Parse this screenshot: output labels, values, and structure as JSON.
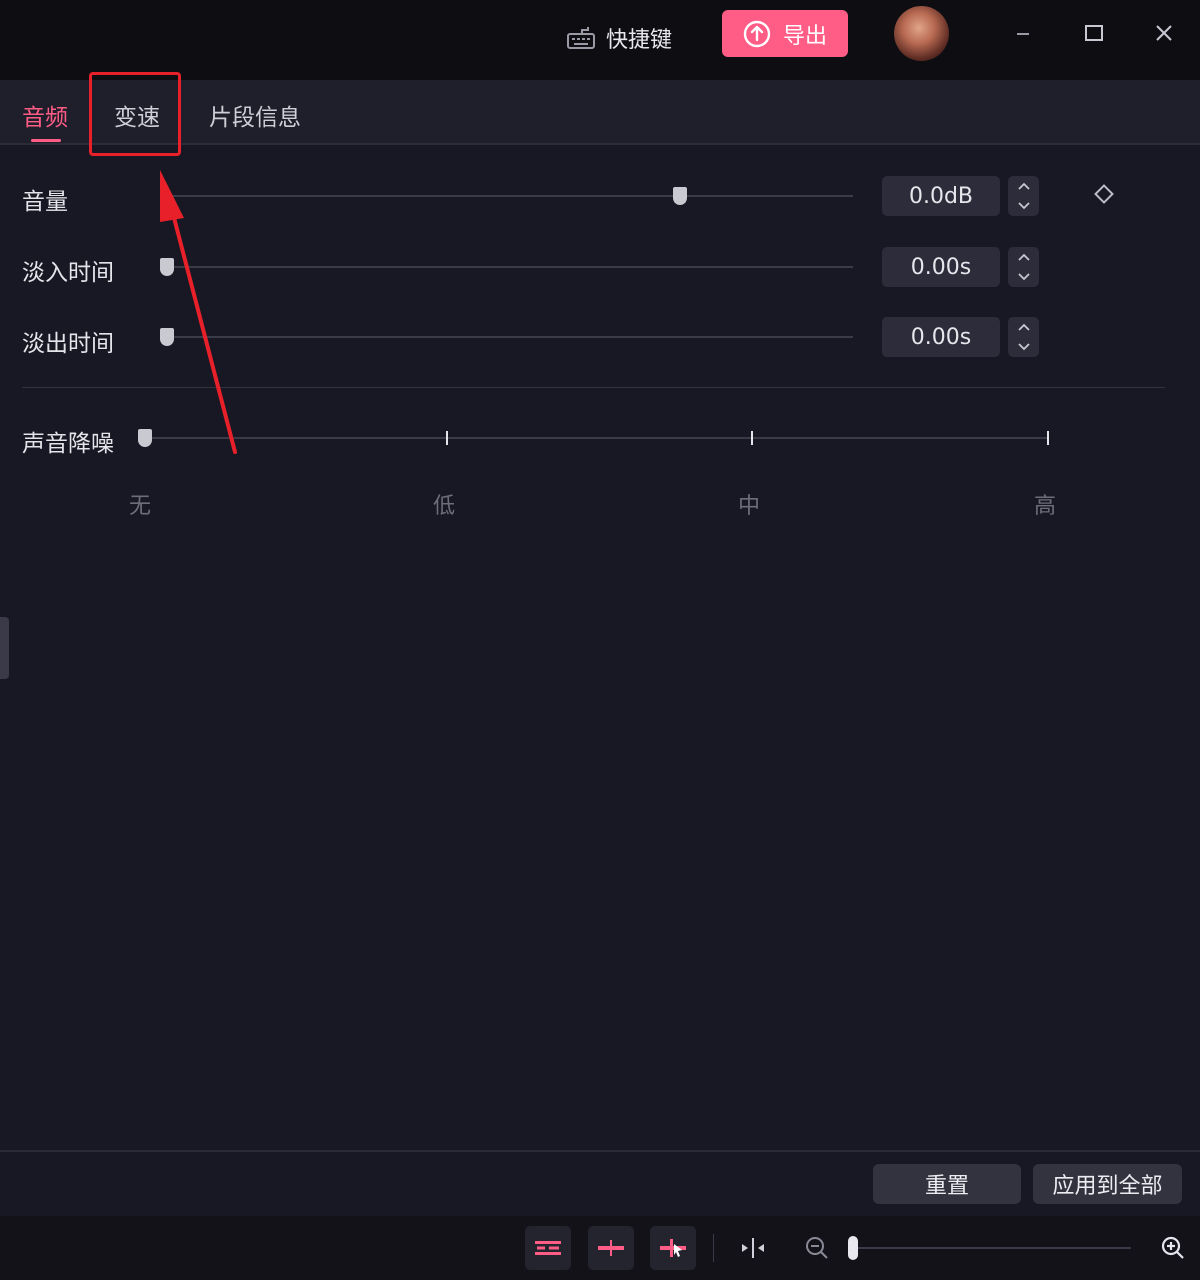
{
  "titlebar": {
    "shortcut_label": "快捷键",
    "shortcut_icon": "keyboard-icon",
    "export_label": "导出",
    "export_icon": "upload-icon",
    "export_color": "#ff5c86"
  },
  "tabs": [
    {
      "label": "音频",
      "active": true
    },
    {
      "label": "变速",
      "active": false
    },
    {
      "label": "片段信息",
      "active": false
    }
  ],
  "audio": {
    "volume": {
      "label": "音量",
      "value": "0.0dB",
      "level": 0.75
    },
    "fade_in": {
      "label": "淡入时间",
      "value": "0.00s",
      "level": 0
    },
    "fade_out": {
      "label": "淡出时间",
      "value": "0.00s",
      "level": 0
    },
    "noise_reduction": {
      "label": "声音降噪",
      "levels": [
        "无",
        "低",
        "中",
        "高"
      ],
      "selected": "无"
    }
  },
  "footer": {
    "reset_label": "重置",
    "apply_all_label": "应用到全部"
  },
  "colors": {
    "accent": "#ff5c86",
    "annotation": "#e8202a",
    "background": "#181824"
  }
}
